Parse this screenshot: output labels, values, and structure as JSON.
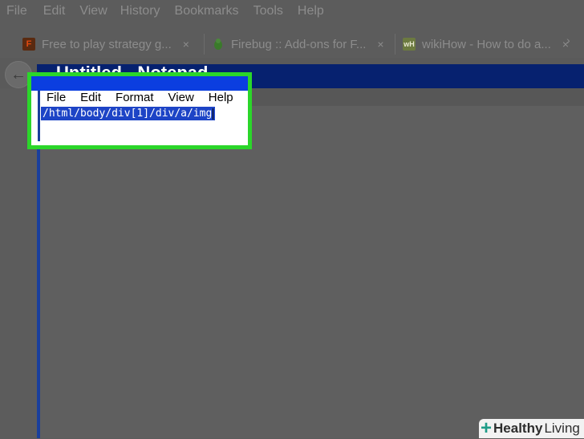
{
  "browser": {
    "menu": [
      "File",
      "Edit",
      "View",
      "History",
      "Bookmarks",
      "Tools",
      "Help"
    ],
    "tabs": [
      {
        "title": "Free to play strategy g...",
        "favicon": "F"
      },
      {
        "title": "Firebug :: Add-ons for F...",
        "favicon": "bug"
      },
      {
        "title": "wikiHow - How to do a...",
        "favicon": "wH"
      }
    ],
    "tab_close": "×",
    "tabs_scroll": "›"
  },
  "notepad": {
    "title": "Untitled - Notepad",
    "menu": [
      "File",
      "Edit",
      "Format",
      "View",
      "Help"
    ],
    "text": "/html/body/div[1]/div/a/img"
  },
  "watermark": {
    "prefix": "Healthy",
    "suffix": "Living"
  },
  "colors": {
    "highlight": "#2bd62a",
    "title_bar": "#06216f",
    "selection": "#1d44c6"
  }
}
